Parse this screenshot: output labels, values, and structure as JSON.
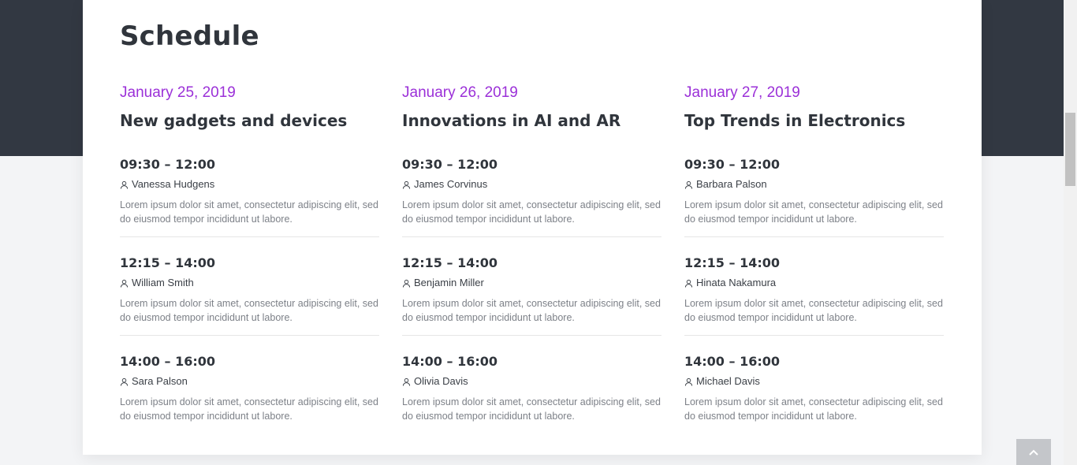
{
  "page": {
    "title": "Schedule"
  },
  "colors": {
    "accent": "#9b30d8",
    "dark": "#323842",
    "heading": "#30353c",
    "muted": "#7d8188"
  },
  "icons": {
    "speaker": "user-icon",
    "back_to_top": "chevron-up-icon"
  },
  "days": [
    {
      "date": "January 25, 2019",
      "title": "New gadgets and devices",
      "sessions": [
        {
          "time": "09:30 – 12:00",
          "speaker": "Vanessa Hudgens",
          "description": "Lorem ipsum dolor sit amet, consectetur adipiscing elit, sed do eiusmod tempor incididunt ut labore."
        },
        {
          "time": "12:15 – 14:00",
          "speaker": "William Smith",
          "description": "Lorem ipsum dolor sit amet, consectetur adipiscing elit, sed do eiusmod tempor incididunt ut labore."
        },
        {
          "time": "14:00 – 16:00",
          "speaker": "Sara Palson",
          "description": "Lorem ipsum dolor sit amet, consectetur adipiscing elit, sed do eiusmod tempor incididunt ut labore."
        }
      ]
    },
    {
      "date": "January 26, 2019",
      "title": "Innovations in AI and AR",
      "sessions": [
        {
          "time": "09:30 – 12:00",
          "speaker": "James Corvinus",
          "description": "Lorem ipsum dolor sit amet, consectetur adipiscing elit, sed do eiusmod tempor incididunt ut labore."
        },
        {
          "time": "12:15 – 14:00",
          "speaker": "Benjamin Miller",
          "description": "Lorem ipsum dolor sit amet, consectetur adipiscing elit, sed do eiusmod tempor incididunt ut labore."
        },
        {
          "time": "14:00 – 16:00",
          "speaker": "Olivia Davis",
          "description": "Lorem ipsum dolor sit amet, consectetur adipiscing elit, sed do eiusmod tempor incididunt ut labore."
        }
      ]
    },
    {
      "date": "January 27, 2019",
      "title": "Top Trends in Electronics",
      "sessions": [
        {
          "time": "09:30 – 12:00",
          "speaker": "Barbara Palson",
          "description": "Lorem ipsum dolor sit amet, consectetur adipiscing elit, sed do eiusmod tempor incididunt ut labore."
        },
        {
          "time": "12:15 – 14:00",
          "speaker": "Hinata Nakamura",
          "description": "Lorem ipsum dolor sit amet, consectetur adipiscing elit, sed do eiusmod tempor incididunt ut labore."
        },
        {
          "time": "14:00 – 16:00",
          "speaker": "Michael Davis",
          "description": "Lorem ipsum dolor sit amet, consectetur adipiscing elit, sed do eiusmod tempor incididunt ut labore."
        }
      ]
    }
  ]
}
